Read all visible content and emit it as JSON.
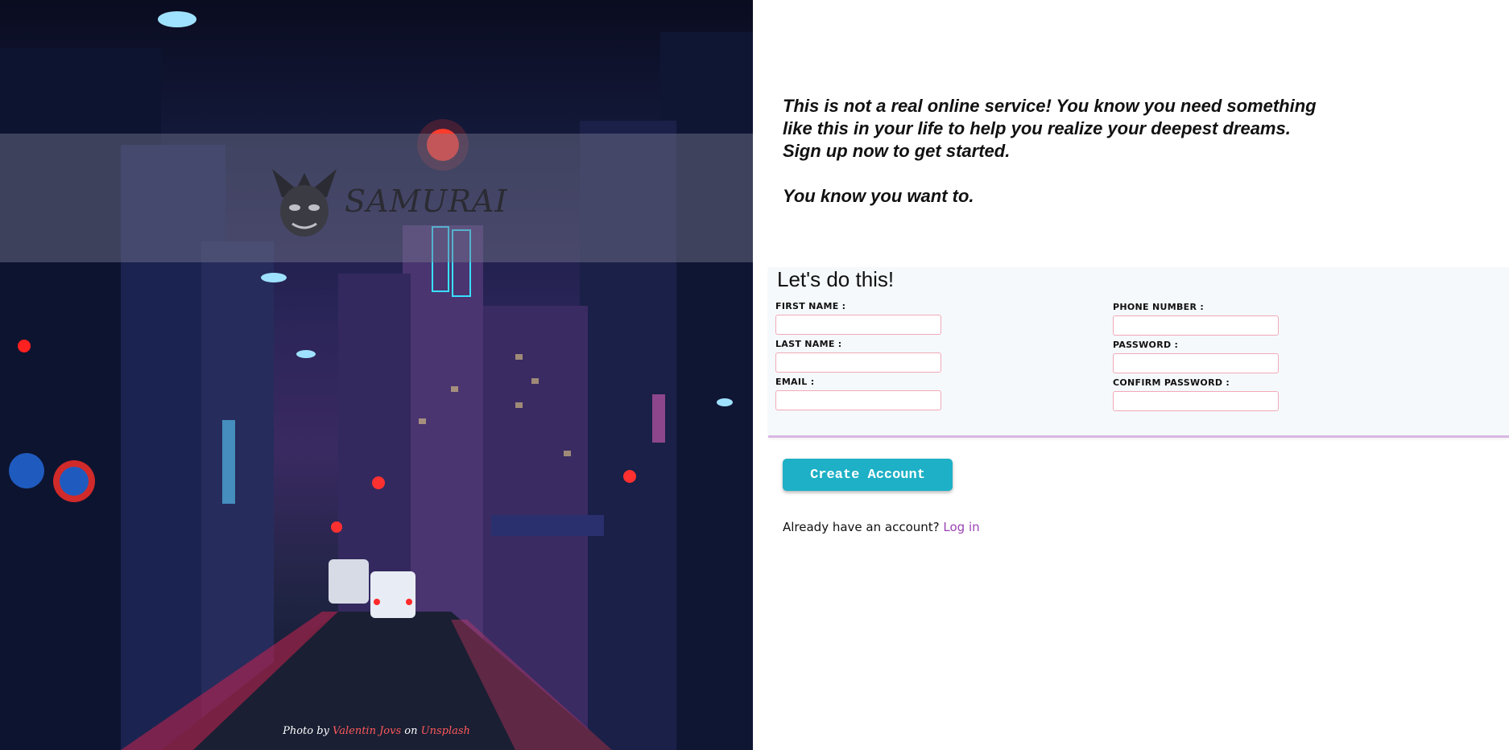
{
  "hero": {
    "logo_text": "SAMURAI",
    "credit": {
      "prefix": "Photo by",
      "photographer": "Valentin Jovs",
      "middle": "on",
      "source": "Unsplash"
    }
  },
  "intro": {
    "lines": [
      "This is not a real online service! You know you need something",
      "like this in your life to help you realize your deepest dreams.",
      "Sign up now to get started."
    ],
    "tagline": "You know you want to."
  },
  "form": {
    "title": "Let's do this!",
    "fields": {
      "first_name": {
        "label": "FIRST NAME :",
        "value": ""
      },
      "last_name": {
        "label": "LAST NAME :",
        "value": ""
      },
      "email": {
        "label": "EMAIL :",
        "value": ""
      },
      "phone": {
        "label": "PHONE NUMBER :",
        "value": ""
      },
      "password": {
        "label": "PASSWORD :",
        "value": ""
      },
      "confirm_password": {
        "label": "CONFIRM PASSWORD :",
        "value": ""
      }
    },
    "submit_label": "Create Account",
    "login_prompt": "Already have an account?",
    "login_link": "Log in"
  },
  "colors": {
    "button": "#1db0c6",
    "link": "#9b43b5",
    "input_border": "#f1a9b7",
    "card_bg": "#f5f9fc"
  }
}
